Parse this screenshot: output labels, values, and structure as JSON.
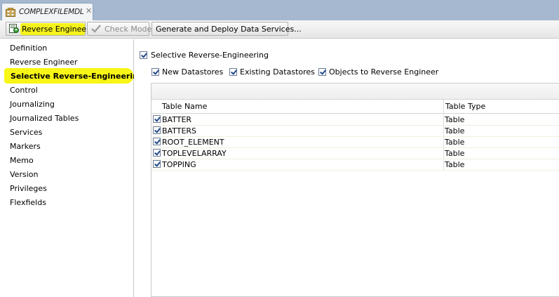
{
  "tab": {
    "title": "COMPLEXFILEMDL",
    "close": "✕"
  },
  "toolbar": {
    "reverse_engineer": "Reverse Engineer",
    "check_model": "Check Model",
    "generate_deploy": "Generate and Deploy Data Services..."
  },
  "nav": {
    "items": [
      "Definition",
      "Reverse Engineer",
      "Selective Reverse-Engineering",
      "Control",
      "Journalizing",
      "Journalized Tables",
      "Services",
      "Markers",
      "Memo",
      "Version",
      "Privileges",
      "Flexfields"
    ],
    "selected_index": 2
  },
  "main": {
    "selective_label": "Selective Reverse-Engineering",
    "options": {
      "new_datastores": "New Datastores",
      "existing_datastores": "Existing Datastores",
      "objects_to_re": "Objects to Reverse Engineer"
    },
    "table": {
      "headers": [
        "Table Name",
        "Table Type"
      ],
      "rows": [
        {
          "name": "BATTER",
          "type": "Table",
          "checked": true
        },
        {
          "name": "BATTERS",
          "type": "Table",
          "checked": true
        },
        {
          "name": "ROOT_ELEMENT",
          "type": "Table",
          "checked": true
        },
        {
          "name": "TOPLEVELARRAY",
          "type": "Table",
          "checked": true
        },
        {
          "name": "TOPPING",
          "type": "Table",
          "checked": true
        }
      ]
    }
  },
  "colors": {
    "highlight": "#f5f21d",
    "tabstrip": "#a5b8cf"
  }
}
